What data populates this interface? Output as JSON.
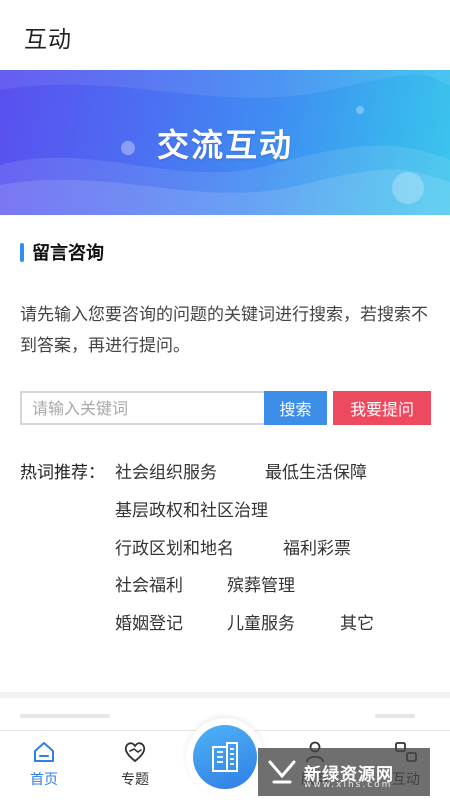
{
  "header": {
    "title": "互动"
  },
  "banner": {
    "title": "交流互动"
  },
  "section": {
    "title": "留言咨询"
  },
  "intro": {
    "text": "请先输入您要咨询的问题的关键词进行搜索，若搜索不到答案，再进行提问。"
  },
  "search": {
    "placeholder": "请输入关键词",
    "value": "",
    "search_label": "搜索",
    "ask_label": "我要提问"
  },
  "hot": {
    "label": "热词推荐：",
    "tags": [
      "社会组织服务",
      "最低生活保障",
      "基层政权和社区治理",
      "行政区划和地名",
      "福利彩票",
      "社会福利",
      "殡葬管理",
      "婚姻登记",
      "儿童服务",
      "其它"
    ]
  },
  "tabbar": {
    "items": [
      {
        "label": "首页",
        "icon": "home-icon",
        "active": true
      },
      {
        "label": "专题",
        "icon": "handshake-heart-icon",
        "active": false
      },
      {
        "label": "",
        "icon": "building-icon",
        "active": false
      },
      {
        "label": "服务",
        "icon": "user-icon",
        "active": false
      },
      {
        "label": "互动",
        "icon": "chat-icon",
        "active": false
      }
    ]
  },
  "watermark": {
    "main": "新绿资源网",
    "sub": "www.xlhs.com"
  },
  "colors": {
    "accent": "#3d8ee9",
    "ask": "#ee4a5f",
    "tab_active": "#2f7fe8"
  }
}
